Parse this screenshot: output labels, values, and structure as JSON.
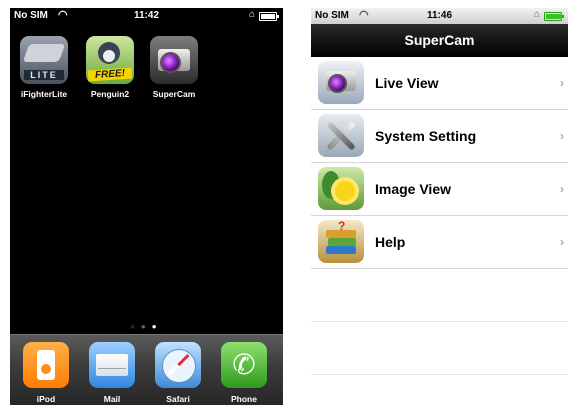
{
  "home_screen": {
    "status": {
      "carrier": "No SIM",
      "time": "11:42",
      "battery_level": 0.85
    },
    "apps": [
      {
        "name": "iFighterLite",
        "badge_text": "LITE",
        "icon": "fighter-jet-icon"
      },
      {
        "name": "Penguin2",
        "badge_text": "FREE!",
        "icon": "penguin-icon"
      },
      {
        "name": "SuperCam",
        "icon": "camera-icon"
      }
    ],
    "page_indicator": {
      "pages": 2,
      "current": 2
    },
    "dock": [
      {
        "name": "iPod",
        "icon": "ipod-icon"
      },
      {
        "name": "Mail",
        "icon": "mail-envelope-icon"
      },
      {
        "name": "Safari",
        "icon": "safari-compass-icon"
      },
      {
        "name": "Phone",
        "icon": "phone-handset-icon"
      }
    ]
  },
  "supercam": {
    "status": {
      "carrier": "No SIM",
      "time": "11:46",
      "battery_level": 1.0,
      "battery_color": "#3bbf2a"
    },
    "nav_title": "SuperCam",
    "menu": [
      {
        "label": "Live View",
        "icon": "camera-icon"
      },
      {
        "label": "System Setting",
        "icon": "tools-icon"
      },
      {
        "label": "Image View",
        "icon": "flower-icon"
      },
      {
        "label": "Help",
        "icon": "books-icon"
      }
    ],
    "chevron": "›"
  }
}
